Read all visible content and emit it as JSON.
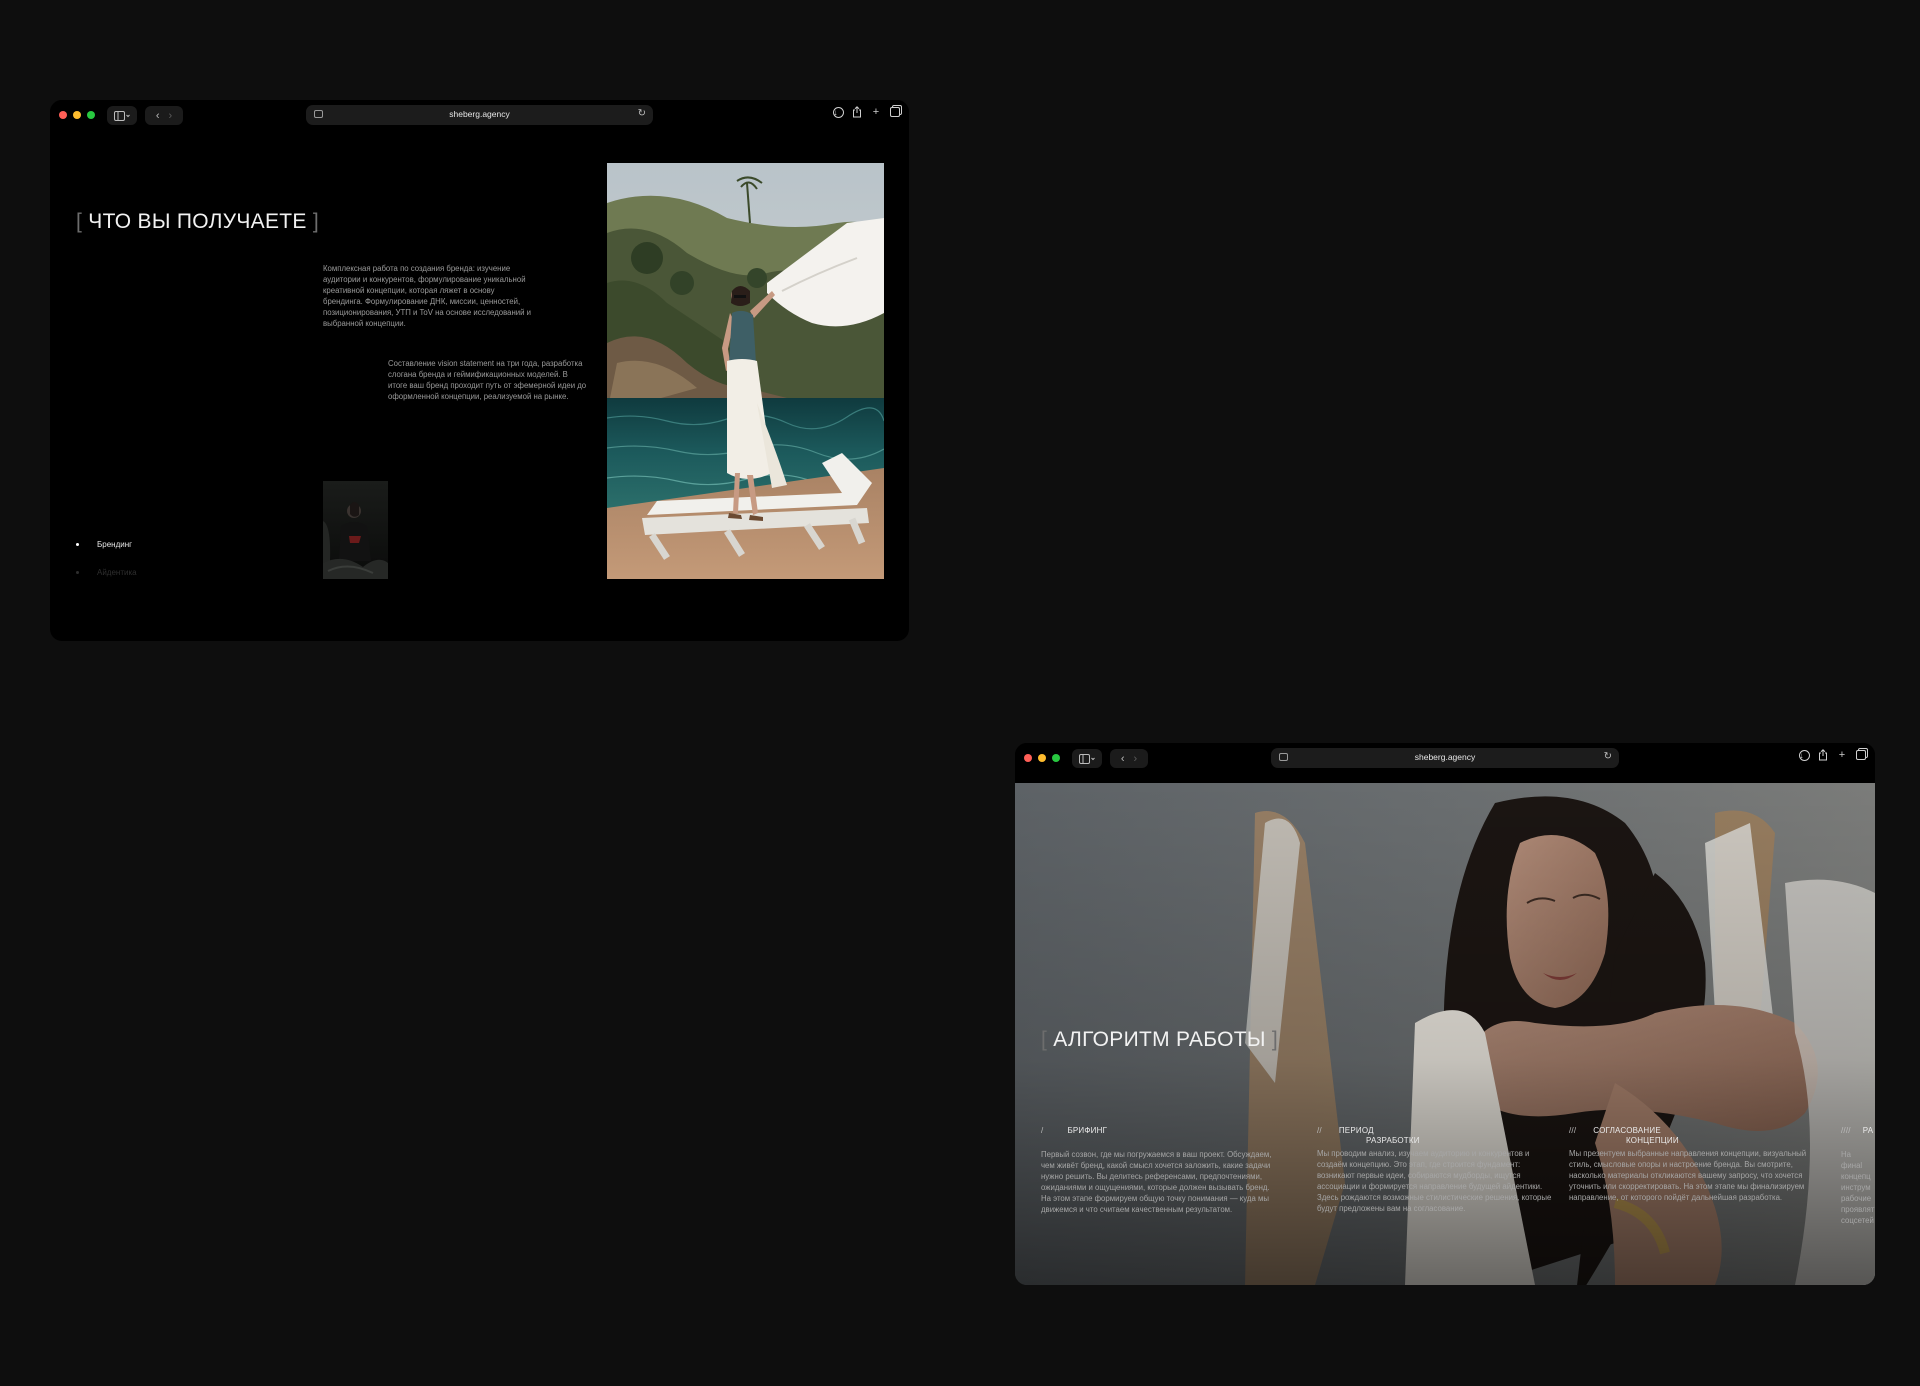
{
  "window1": {
    "url": "sheberg.agency",
    "heading": "ЧТО ВЫ ПОЛУЧАЕТЕ",
    "paragraph1": "Комплексная работа по создания бренда: изучение аудитории и конкурентов, формулирование уникальной креативной концепции, которая ляжет в основу брендинга. Формулирование ДНК, миссии, ценностей, позиционирования, УТП и ToV на основе исследований и выбранной концепции.",
    "paragraph2": "Составление vision statement на три года, разработка слогана бренда и геймификационных моделей. В итоге ваш бренд проходит путь от эфемерной идеи до оформленной концепции, реализуемой на рынке.",
    "list": [
      "Брендинг",
      "Айдентика"
    ]
  },
  "window2": {
    "url": "sheberg.agency",
    "heading": "АЛГОРИТМ РАБОТЫ",
    "steps": [
      {
        "num": "/",
        "title": "БРИФИНГ",
        "title2": "",
        "text": "Первый созвон, где мы погружаемся в ваш проект. Обсуждаем, чем живёт бренд, какой смысл хочется заложить, какие задачи нужно решить. Вы делитесь референсами, предпочтениями, ожиданиями и ощущениями, которые должен вызывать бренд. На этом этапе формируем общую точку понимания — куда мы движемся и что считаем качественным результатом."
      },
      {
        "num": "//",
        "title": "ПЕРИОД",
        "title2": "РАЗРАБОТКИ",
        "text": "Мы проводим анализ, изучаем аудиторию и конкурентов и создаём концепцию. Это этап, где строится фундамент: возникают первые идеи, собираются мудборды, ищутся ассоциации и формируется направление будущей айдентики. Здесь рождаются возможные стилистические решения, которые будут предложены вам на согласование."
      },
      {
        "num": "///",
        "title": "СОГЛАСОВАНИЕ",
        "title2": "КОНЦЕПЦИИ",
        "text": "Мы презентуем выбранные направления концепции, визуальный стиль, смысловые опоры и настроение бренда. Вы смотрите, насколько материалы откликаются вашему запросу, что хочется уточнить или скорректировать. На этом этапе мы финализируем направление, от которого пойдёт дальнейшая разработка."
      },
      {
        "num": "////",
        "title": "РА",
        "title2": "",
        "text": "На финаl концепц инструм рабочие проявлят соцсетей"
      }
    ]
  },
  "icons": {
    "sidebar": "sidebar-icon",
    "back": "chevron-left-icon",
    "forward": "chevron-right-icon",
    "lock": "site-settings-icon",
    "reload": "reload-icon",
    "download": "download-icon",
    "share": "share-icon",
    "new_tab": "plus-icon",
    "tabs": "tabs-overview-icon"
  },
  "colors": {
    "page_bg": "#0e0e0e",
    "window_bg": "#000000",
    "traffic_red": "#ff5f57",
    "traffic_yellow": "#febc2e",
    "traffic_green": "#28c840"
  }
}
